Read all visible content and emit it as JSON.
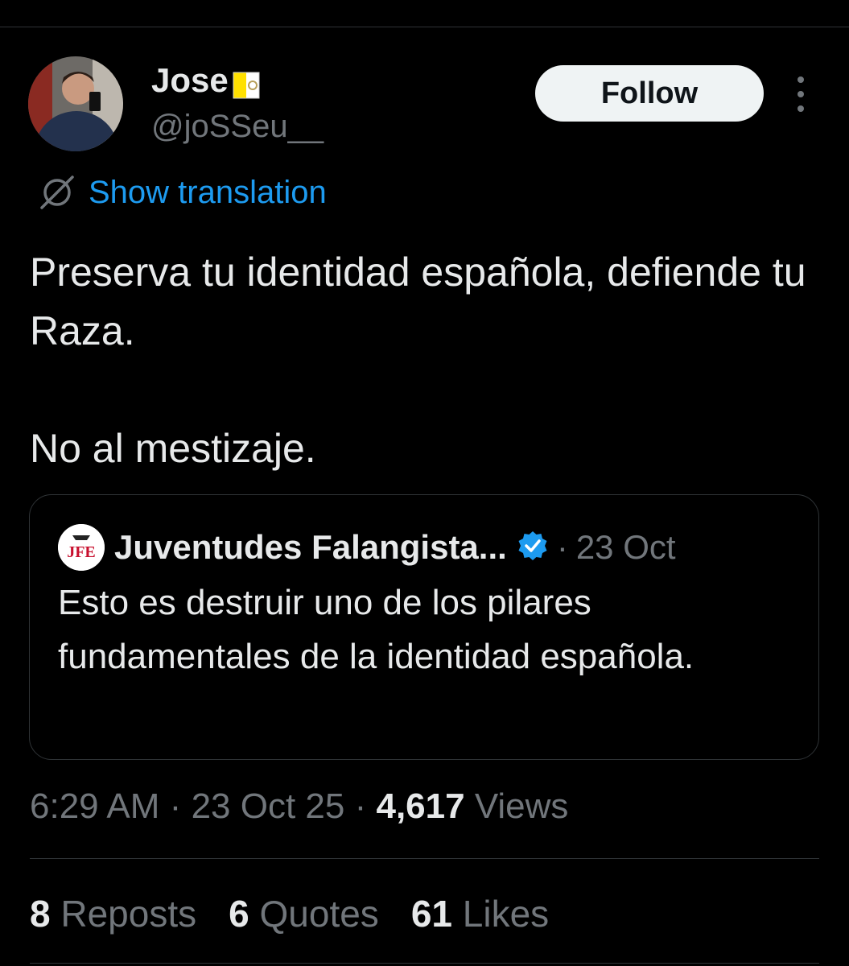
{
  "author": {
    "display_name": "Jose",
    "handle": "@joSSeu__",
    "name_emoji": "vatican-flag-icon"
  },
  "actions": {
    "follow_label": "Follow",
    "more_icon": "more-vertical-icon"
  },
  "translation": {
    "label": "Show translation",
    "icon": "translate-globe-icon"
  },
  "tweet": {
    "paragraphs": [
      "Preserva tu identidad española, defiende tu Raza.",
      "No al mestizaje."
    ]
  },
  "quoted": {
    "name": "Juventudes Falangista...",
    "verified": true,
    "separator": "·",
    "date": "23 Oct",
    "text": "Esto es destruir uno de los pilares fundamentales de la identidad española.",
    "avatar_letters": "JFE"
  },
  "meta": {
    "time": "6:29 AM",
    "sep1": "·",
    "date": "23 Oct 25",
    "sep2": "·",
    "views_count": "4,617",
    "views_label": "Views"
  },
  "stats": {
    "reposts_count": "8",
    "reposts_label": "Reposts",
    "quotes_count": "6",
    "quotes_label": "Quotes",
    "likes_count": "61",
    "likes_label": "Likes"
  },
  "colors": {
    "background": "#000000",
    "text_primary": "#e7e9ea",
    "text_secondary": "#71767b",
    "link": "#1d9bf0",
    "verified": "#1d9bf0",
    "border": "#2f3336"
  }
}
